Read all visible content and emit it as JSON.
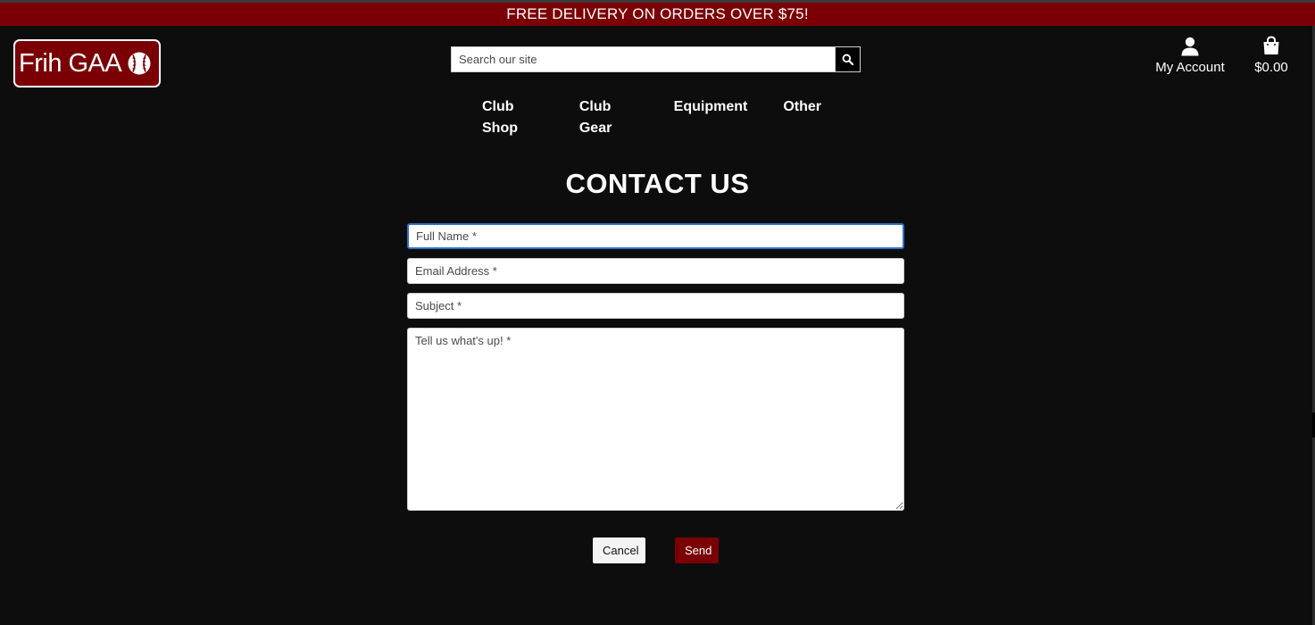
{
  "banner": {
    "text": "FREE DELIVERY ON ORDERS OVER $75!"
  },
  "brand": {
    "name": "Frih GAA",
    "icon": "sliotar-ball-icon"
  },
  "search": {
    "placeholder": "Search our site",
    "value": "",
    "icon": "search-icon"
  },
  "account": {
    "label": "My Account",
    "icon": "user-icon"
  },
  "bag": {
    "total": "$0.00",
    "icon": "shopping-bag-icon"
  },
  "nav": {
    "items": [
      {
        "label": "Club Shop"
      },
      {
        "label": "Club Gear"
      },
      {
        "label": "Equipment"
      },
      {
        "label": "Other"
      }
    ]
  },
  "contact": {
    "title": "CONTACT US",
    "fields": {
      "full_name": {
        "placeholder": "Full Name *",
        "value": ""
      },
      "email": {
        "placeholder": "Email Address *",
        "value": ""
      },
      "subject": {
        "placeholder": "Subject *",
        "value": ""
      },
      "message": {
        "placeholder": "Tell us what's up! *",
        "value": ""
      }
    },
    "cancel_label": "Cancel",
    "send_label": "Send"
  },
  "colors": {
    "brand_red": "#7a0006",
    "background": "#0d0d0d",
    "focus_blue": "#2f6fce"
  }
}
